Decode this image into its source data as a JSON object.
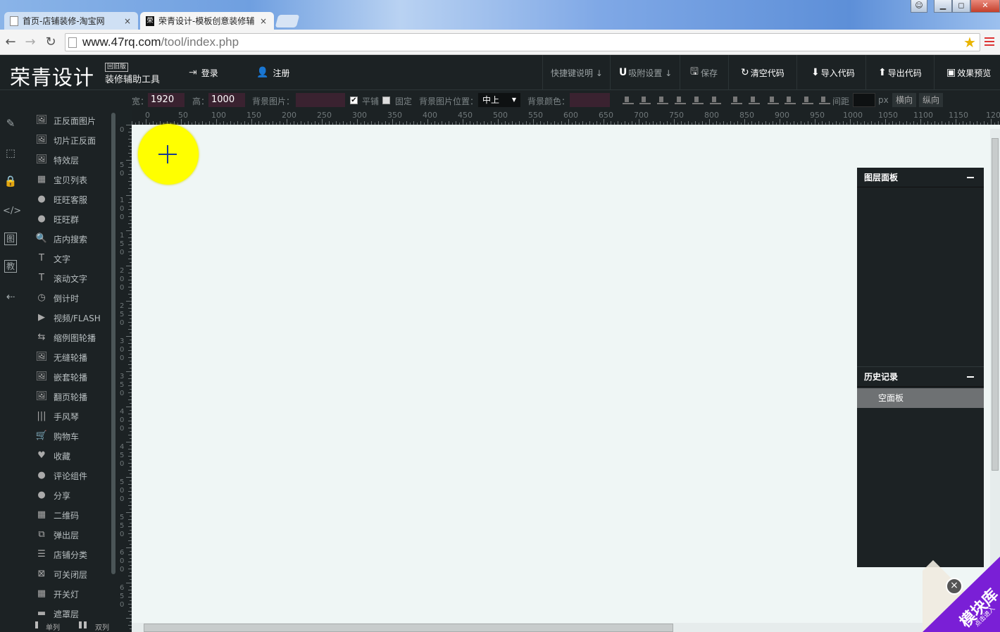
{
  "browser": {
    "tabs": [
      {
        "title": "首页-店铺装修-淘宝网",
        "close": "×"
      },
      {
        "title": "荣青设计-模板创意装修辅",
        "close": "×",
        "favicon_text": "荣"
      }
    ],
    "url_host": "www.47rq.com",
    "url_path": "/tool/index.php",
    "window_controls": [
      "▁",
      "◻",
      "✕"
    ]
  },
  "app": {
    "logo": "荣青设计",
    "logo_badge": "回旧版",
    "logo_subtitle": "装修辅助工具",
    "login": "登录",
    "register": "注册",
    "actions": {
      "shortcuts": "快捷键说明 ↓",
      "snap": "吸附设置 ↓",
      "save": "保存",
      "clear_code": "清空代码",
      "import_code": "导入代码",
      "export_code": "导出代码",
      "preview": "效果预览"
    }
  },
  "toolbar": {
    "width_label": "宽：",
    "width_value": "1920",
    "height_label": "高：",
    "height_value": "1000",
    "bg_image_label": "背景图片：",
    "tile_label": "平铺",
    "tile_checked": true,
    "fixed_label": "固定",
    "fixed_checked": false,
    "bg_position_label": "背景图片位置：",
    "bg_position_value": "中上",
    "bg_color_label": "背景颜色：",
    "spacing_label": "间距",
    "unit": "px",
    "horizontal": "横向",
    "vertical": "纵向"
  },
  "ruler_top": [
    "0",
    "50",
    "100",
    "150",
    "200",
    "250",
    "300",
    "350",
    "400",
    "450",
    "500",
    "550",
    "600",
    "650",
    "700",
    "750",
    "800",
    "850",
    "900",
    "950",
    "1000",
    "1050",
    "1100",
    "1150",
    "120"
  ],
  "ruler_left": [
    "0",
    "50",
    "100",
    "150",
    "200",
    "250",
    "300",
    "350",
    "400",
    "450",
    "500",
    "550",
    "600",
    "650"
  ],
  "iconbar": [
    "edit-icon",
    "select-icon",
    "lock-icon",
    "code-icon",
    "image-icon",
    "tutorial-icon",
    "back-icon"
  ],
  "iconbar_glyphs": {
    "image": "图",
    "tutorial": "教"
  },
  "components": [
    {
      "label": "正反面图片",
      "icon": "image"
    },
    {
      "label": "切片正反面",
      "icon": "image"
    },
    {
      "label": "特效层",
      "icon": "image"
    },
    {
      "label": "宝贝列表",
      "icon": "grid"
    },
    {
      "label": "旺旺客服",
      "icon": "chat"
    },
    {
      "label": "旺旺群",
      "icon": "group"
    },
    {
      "label": "店内搜索",
      "icon": "search"
    },
    {
      "label": "文字",
      "icon": "text"
    },
    {
      "label": "滚动文字",
      "icon": "text"
    },
    {
      "label": "倒计时",
      "icon": "clock"
    },
    {
      "label": "视频/FLASH",
      "icon": "play"
    },
    {
      "label": "缩例图轮播",
      "icon": "carousel"
    },
    {
      "label": "无缝轮播",
      "icon": "image"
    },
    {
      "label": "嵌套轮播",
      "icon": "image"
    },
    {
      "label": "翻页轮播",
      "icon": "image"
    },
    {
      "label": "手风琴",
      "icon": "accordion"
    },
    {
      "label": "购物车",
      "icon": "cart"
    },
    {
      "label": "收藏",
      "icon": "heart"
    },
    {
      "label": "评论组件",
      "icon": "comment"
    },
    {
      "label": "分享",
      "icon": "comment"
    },
    {
      "label": "二维码",
      "icon": "qrcode"
    },
    {
      "label": "弹出层",
      "icon": "popup"
    },
    {
      "label": "店铺分类",
      "icon": "list"
    },
    {
      "label": "可关闭层",
      "icon": "closable"
    },
    {
      "label": "开关灯",
      "icon": "grid"
    },
    {
      "label": "遮罩层",
      "icon": "mask"
    }
  ],
  "column_mode": {
    "single": "单列",
    "double": "双列"
  },
  "layers_panel": {
    "title": "图层面板"
  },
  "history_panel": {
    "title": "历史记录",
    "items": [
      "空面板"
    ]
  },
  "module_library": {
    "title": "模块库",
    "subtitle": "点击进入"
  },
  "colors": {
    "accent_yellow": "#ffff00",
    "dark_bg": "#1c2224",
    "canvas_bg": "#eff6f5",
    "module_purple": "#7a1fd6"
  }
}
